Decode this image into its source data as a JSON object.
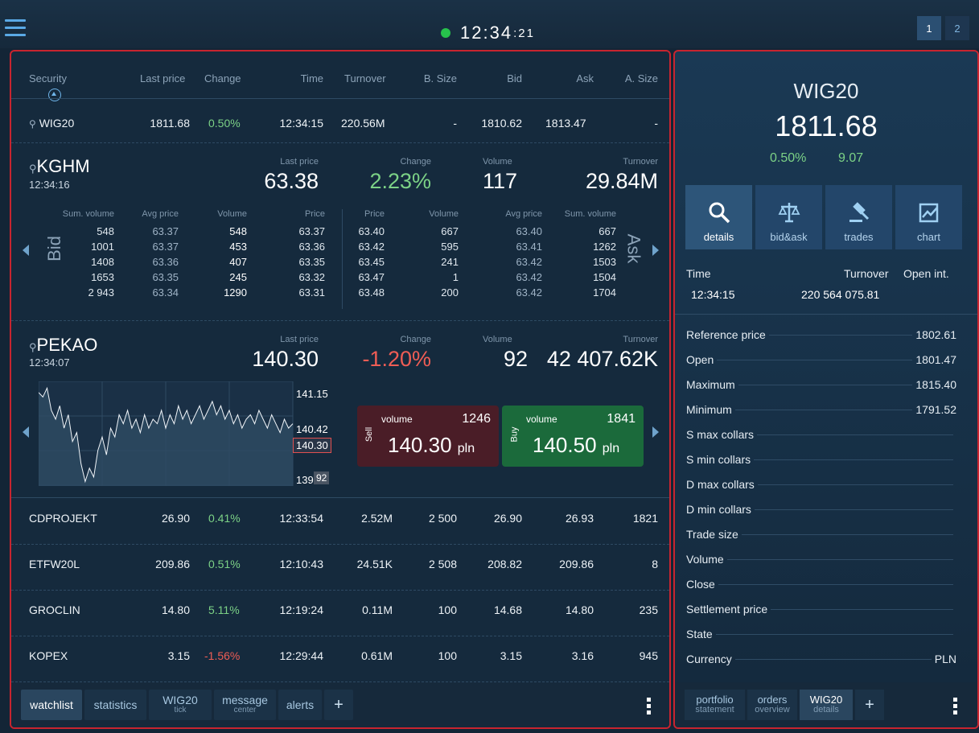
{
  "topbar": {
    "time_main": "12:34",
    "time_sec": ":21",
    "pages": [
      "1",
      "2"
    ]
  },
  "watch": {
    "headers": [
      "Security",
      "Last price",
      "Change",
      "Time",
      "Turnover",
      "B. Size",
      "Bid",
      "Ask",
      "A. Size"
    ],
    "wig": {
      "name": "WIG20",
      "last": "1811.68",
      "change": "0.50%",
      "time": "12:34:15",
      "turnover": "220.56M",
      "bsize": "-",
      "bid": "1810.62",
      "ask": "1813.47",
      "asize": "-"
    }
  },
  "kghm": {
    "name": "KGHM",
    "time": "12:34:16",
    "labels": {
      "last": "Last price",
      "change": "Change",
      "volume": "Volume",
      "turnover": "Turnover"
    },
    "last": "63.38",
    "change": "2.23%",
    "volume": "117",
    "turnover": "29.84M",
    "bid_headers": [
      "Sum. volume",
      "Avg price",
      "Volume",
      "Price"
    ],
    "ask_headers": [
      "Price",
      "Volume",
      "Avg price",
      "Sum. volume"
    ],
    "bid_label": "Bid",
    "ask_label": "Ask",
    "bids": [
      [
        "548",
        "63.37",
        "548",
        "63.37"
      ],
      [
        "1001",
        "63.37",
        "453",
        "63.36"
      ],
      [
        "1408",
        "63.36",
        "407",
        "63.35"
      ],
      [
        "1653",
        "63.35",
        "245",
        "63.32"
      ],
      [
        "2 943",
        "63.34",
        "1290",
        "63.31"
      ]
    ],
    "asks": [
      [
        "63.40",
        "667",
        "63.40",
        "667"
      ],
      [
        "63.42",
        "595",
        "63.41",
        "1262"
      ],
      [
        "63.45",
        "241",
        "63.42",
        "1503"
      ],
      [
        "63.47",
        "1",
        "63.42",
        "1504"
      ],
      [
        "63.48",
        "200",
        "63.42",
        "1704"
      ]
    ]
  },
  "pekao": {
    "name": "PEKAO",
    "time": "12:34:07",
    "labels": {
      "last": "Last price",
      "change": "Change",
      "volume": "Volume",
      "turnover": "Turnover"
    },
    "last": "140.30",
    "change": "-1.20%",
    "volume": "92",
    "turnover": "42 407.62K",
    "chart": {
      "ymax": "141.15",
      "ylast": "140.30",
      "ymid": "140.42",
      "ymin": "139",
      "vol": "92"
    },
    "sell": {
      "side": "Sell",
      "vol_label": "volume",
      "volume": "1246",
      "price": "140.30",
      "unit": "pln"
    },
    "buy": {
      "side": "Buy",
      "vol_label": "volume",
      "volume": "1841",
      "price": "140.50",
      "unit": "pln"
    }
  },
  "rows": [
    {
      "name": "CDPROJEKT",
      "last": "26.90",
      "change": "0.41%",
      "pos": true,
      "time": "12:33:54",
      "turnover": "2.52M",
      "bsize": "2 500",
      "bid": "26.90",
      "ask": "26.93",
      "asize": "1821"
    },
    {
      "name": "ETFW20L",
      "last": "209.86",
      "change": "0.51%",
      "pos": true,
      "time": "12:10:43",
      "turnover": "24.51K",
      "bsize": "2 508",
      "bid": "208.82",
      "ask": "209.86",
      "asize": "8"
    },
    {
      "name": "GROCLIN",
      "last": "14.80",
      "change": "5.11%",
      "pos": true,
      "time": "12:19:24",
      "turnover": "0.11M",
      "bsize": "100",
      "bid": "14.68",
      "ask": "14.80",
      "asize": "235"
    },
    {
      "name": "KOPEX",
      "last": "3.15",
      "change": "-1.56%",
      "pos": false,
      "time": "12:29:44",
      "turnover": "0.61M",
      "bsize": "100",
      "bid": "3.15",
      "ask": "3.16",
      "asize": "945"
    }
  ],
  "left_tabs": {
    "watchlist": "watchlist",
    "statistics": "statistics",
    "wig20": "WIG20",
    "wig20_sub": "tick",
    "message": "message",
    "message_sub": "center",
    "alerts": "alerts",
    "add": "+"
  },
  "detail": {
    "title": "WIG20",
    "price": "1811.68",
    "change_pct": "0.50%",
    "change_abs": "9.07",
    "tools": [
      "details",
      "bid&ask",
      "trades",
      "chart"
    ],
    "time_label": "Time",
    "turnover_label": "Turnover",
    "openint_label": "Open int.",
    "time": "12:34:15",
    "turnover": "220 564 075.81",
    "fields": [
      [
        "Reference price",
        "1802.61"
      ],
      [
        "Open",
        "1801.47"
      ],
      [
        "Maximum",
        "1815.40"
      ],
      [
        "Minimum",
        "1791.52"
      ],
      [
        "S max collars",
        ""
      ],
      [
        "S min collars",
        ""
      ],
      [
        "D max collars",
        ""
      ],
      [
        "D min collars",
        ""
      ],
      [
        "Trade size",
        ""
      ],
      [
        "Volume",
        ""
      ],
      [
        "Close",
        ""
      ],
      [
        "Settlement price",
        ""
      ],
      [
        "State",
        ""
      ],
      [
        "Currency",
        "PLN"
      ]
    ]
  },
  "right_tabs": {
    "portfolio": "portfolio",
    "portfolio_sub": "statement",
    "orders": "orders",
    "orders_sub": "overview",
    "wig20": "WIG20",
    "wig20_sub": "details",
    "add": "+"
  },
  "colors": {
    "positive": "#7cd286",
    "negative": "#ef5d55",
    "accent": "#5aa9e6",
    "border": "#c8242f",
    "sell": "#4a1d27",
    "buy": "#1b6a3b"
  },
  "series": [
    141.0,
    140.9,
    141.1,
    140.6,
    140.4,
    140.7,
    140.2,
    140.5,
    139.9,
    140.1,
    139.4,
    139.0,
    139.3,
    139.1,
    139.7,
    140.0,
    139.6,
    140.2,
    140.0,
    140.5,
    140.3,
    140.6,
    140.2,
    140.4,
    140.1,
    140.5,
    140.2,
    140.4,
    140.3,
    140.6,
    140.2,
    140.5,
    140.3,
    140.7,
    140.4,
    140.6,
    140.3,
    140.5,
    140.7,
    140.4,
    140.6,
    140.8,
    140.5,
    140.7,
    140.4,
    140.6,
    140.3,
    140.5,
    140.2,
    140.4,
    140.5,
    140.3,
    140.6,
    140.4,
    140.2,
    140.5,
    140.3,
    140.1,
    140.4,
    140.2,
    140.3
  ]
}
